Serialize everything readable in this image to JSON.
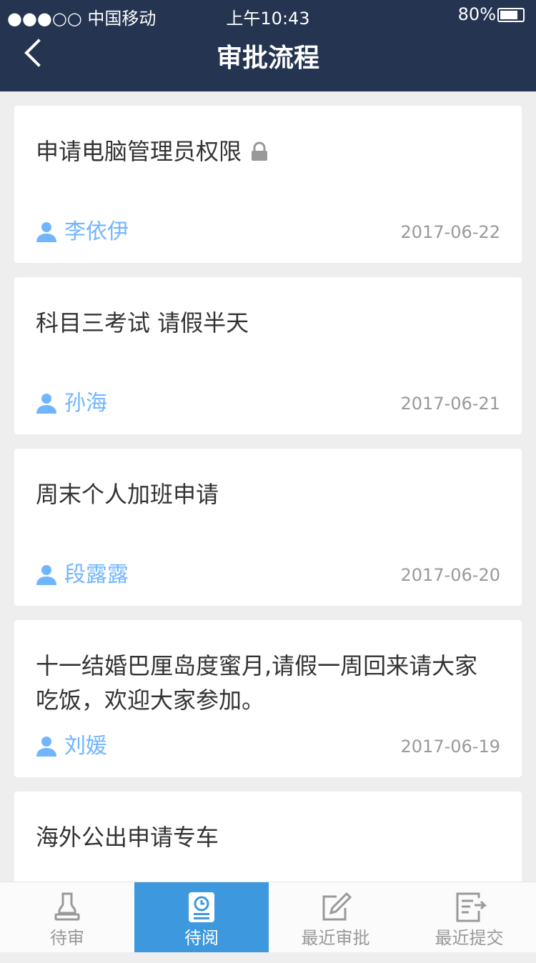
{
  "status": {
    "carrier": "●●●○○ 中国移动",
    "time": "上午10:43",
    "battery": "80%"
  },
  "header": {
    "title": "审批流程"
  },
  "cards": [
    {
      "subject": "申请电脑管理员权限",
      "locked": true,
      "person": "李依伊",
      "date": "2017-06-22"
    },
    {
      "subject": "科目三考试 请假半天",
      "locked": false,
      "person": "孙海",
      "date": "2017-06-21"
    },
    {
      "subject": "周末个人加班申请",
      "locked": false,
      "person": "段露露",
      "date": "2017-06-20"
    },
    {
      "subject": "十一结婚巴厘岛度蜜月,请假一周回来请大家吃饭，欢迎大家参加。",
      "locked": false,
      "person": "刘媛",
      "date": "2017-06-19"
    },
    {
      "subject": "海外公出申请专车",
      "locked": false,
      "person": "",
      "date": ""
    }
  ],
  "tabs": [
    {
      "label": "待审",
      "icon": "stamp-icon",
      "active": false
    },
    {
      "label": "待阅",
      "icon": "document-clock-icon",
      "active": true
    },
    {
      "label": "最近审批",
      "icon": "edit-icon",
      "active": false
    },
    {
      "label": "最近提交",
      "icon": "submit-icon",
      "active": false
    }
  ],
  "colors": {
    "header_bg": "#243451",
    "page_bg": "#eeeeee",
    "person": "#71b5ff",
    "tab_active": "#3d98de",
    "tab_bg": "#fbfbfb"
  }
}
